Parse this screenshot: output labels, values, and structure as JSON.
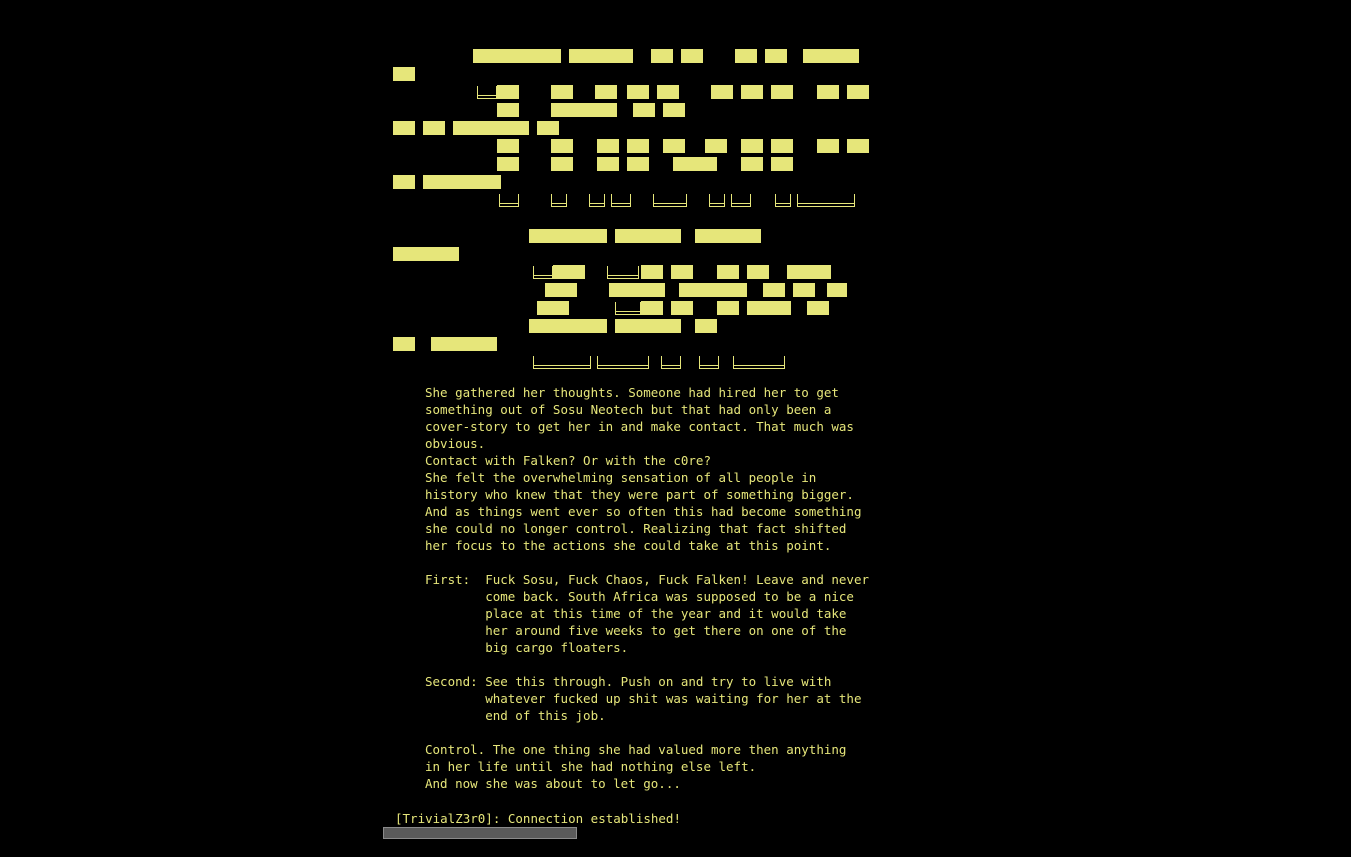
{
  "colors": {
    "background": "#000000",
    "text": "#e6e67a",
    "scrollbar": "#5a5a5a"
  },
  "banner": {
    "icon": "ascii-art-title-block-letters"
  },
  "story": {
    "lines": [
      "She gathered her thoughts. Someone had hired her to get",
      "something out of Sosu Neotech but that had only been a",
      "cover-story to get her in and make contact. That much was",
      "obvious.",
      "Contact with Falken? Or with the c0re?",
      "She felt the overwhelming sensation of all people in",
      "history who knew that they were part of something bigger.",
      "And as things went ever so often this had become something",
      "she could no longer control. Realizing that fact shifted",
      "her focus to the actions she could take at this point.",
      "",
      "First:  Fuck Sosu, Fuck Chaos, Fuck Falken! Leave and never",
      "        come back. South Africa was supposed to be a nice",
      "        place at this time of the year and it would take",
      "        her around five weeks to get there on one of the",
      "        big cargo floaters.",
      "",
      "Second: See this through. Push on and try to live with",
      "        whatever fucked up shit was waiting for her at the",
      "        end of this job.",
      "",
      "Control. The one thing she had valued more then anything",
      "in her life until she had nothing else left.",
      "And now she was about to let go..."
    ]
  },
  "status": {
    "message": "[TrivialZ3r0]: Connection established!"
  }
}
